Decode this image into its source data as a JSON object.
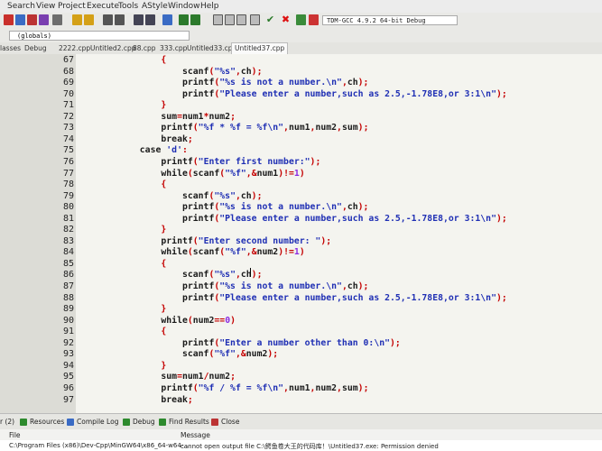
{
  "menu": [
    "Search",
    "View",
    "Project",
    "Execute",
    "Tools",
    "AStyle",
    "Window",
    "Help"
  ],
  "compiler": "TDM-GCC 4.9.2 64-bit Debug",
  "scope": "(globals)",
  "tabs": {
    "left_labels": [
      "lasses",
      "Debug"
    ],
    "files": [
      "2222.cpp",
      "Untitled2.cpp",
      "88.cpp",
      "333.cpp",
      "Untitled33.cpp",
      "Untitled37.cpp"
    ],
    "active": "Untitled37.cpp"
  },
  "code_lines": [
    {
      "n": "67",
      "fold": "minus",
      "text": "                {"
    },
    {
      "n": "68",
      "fold": "",
      "text": "                    scanf(\"%s\",ch);"
    },
    {
      "n": "69",
      "fold": "",
      "text": "                    printf(\"%s is not a number.\\n\",ch);"
    },
    {
      "n": "70",
      "fold": "",
      "text": "                    printf(\"Please enter a number,such as 2.5,-1.78E8,or 3:1\\n\");"
    },
    {
      "n": "71",
      "fold": "",
      "text": "                }"
    },
    {
      "n": "72",
      "fold": "",
      "text": "                sum=num1*num2;"
    },
    {
      "n": "73",
      "fold": "",
      "text": "                printf(\"%f * %f = %f\\n\",num1,num2,sum);"
    },
    {
      "n": "74",
      "fold": "",
      "text": "                break;"
    },
    {
      "n": "75",
      "fold": "",
      "text": "            case 'd':"
    },
    {
      "n": "76",
      "fold": "",
      "text": "                printf(\"Enter first number:\");"
    },
    {
      "n": "77",
      "fold": "",
      "text": "                while(scanf(\"%f\",&num1)!=1)"
    },
    {
      "n": "78",
      "fold": "minus",
      "text": "                {"
    },
    {
      "n": "79",
      "fold": "",
      "text": "                    scanf(\"%s\",ch);"
    },
    {
      "n": "80",
      "fold": "",
      "text": "                    printf(\"%s is not a number.\\n\",ch);"
    },
    {
      "n": "81",
      "fold": "",
      "text": "                    printf(\"Please enter a number,such as 2.5,-1.78E8,or 3:1\\n\");"
    },
    {
      "n": "82",
      "fold": "",
      "text": "                }"
    },
    {
      "n": "83",
      "fold": "",
      "text": "                printf(\"Enter second number: \");"
    },
    {
      "n": "84",
      "fold": "",
      "text": "                while(scanf(\"%f\",&num2)!=1)"
    },
    {
      "n": "85",
      "fold": "minus",
      "text": "                {"
    },
    {
      "n": "86",
      "fold": "",
      "text": "                    scanf(\"%s\",ch);"
    },
    {
      "n": "87",
      "fold": "",
      "text": "                    printf(\"%s is not a number.\\n\",ch);"
    },
    {
      "n": "88",
      "fold": "",
      "text": "                    printf(\"Please enter a number,such as 2.5,-1.78E8,or 3:1\\n\");"
    },
    {
      "n": "89",
      "fold": "",
      "text": "                }"
    },
    {
      "n": "90",
      "fold": "",
      "text": "                while(num2==0)"
    },
    {
      "n": "91",
      "fold": "minus",
      "text": "                {"
    },
    {
      "n": "92",
      "fold": "",
      "text": "                    printf(\"Enter a number other than 0:\\n\");"
    },
    {
      "n": "93",
      "fold": "",
      "text": "                    scanf(\"%f\",&num2);"
    },
    {
      "n": "94",
      "fold": "",
      "text": "                }"
    },
    {
      "n": "95",
      "fold": "",
      "text": "                sum=num1/num2;"
    },
    {
      "n": "96",
      "fold": "",
      "text": "                printf(\"%f / %f = %f\\n\",num1,num2,sum);"
    },
    {
      "n": "97",
      "fold": "",
      "text": "                break;"
    }
  ],
  "bottom_tabs": [
    "r (2)",
    "Resources",
    "Compile Log",
    "Debug",
    "Find Results",
    "Close"
  ],
  "messages": {
    "header_file": "File",
    "header_message": "Message",
    "row_file": "C:\\Program Files (x86)\\Dev-Cpp\\MinGW64\\x86_64-w64-...",
    "row_message": "cannot open output file C:\\鳄鱼卷大王的代码库！\\Untitled37.exe: Permission denied"
  }
}
